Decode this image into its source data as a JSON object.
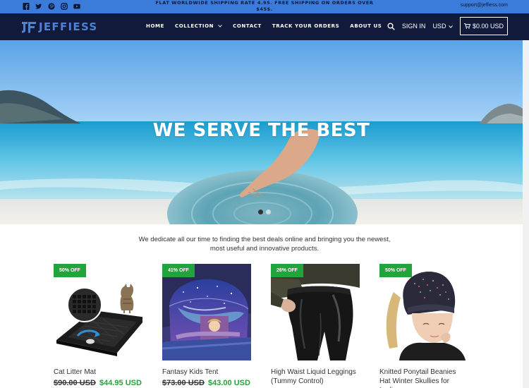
{
  "topbar": {
    "social_icons": [
      "facebook-icon",
      "twitter-icon",
      "pinterest-icon",
      "instagram-icon",
      "youtube-icon"
    ],
    "announcement": "FLAT WORLDWIDE SHIPPING RATE 4.95. FREE SHIPPING ON ORDERS OVER $45$.",
    "support_email": "support@jeffiess.com"
  },
  "header": {
    "logo_text": "JEFFIESS",
    "nav": [
      "HOME",
      "COLLECTION",
      "CONTACT",
      "TRACK YOUR ORDERS",
      "ABOUT US"
    ],
    "collection_chevron": "⌄",
    "signin": "SIGN IN",
    "currency": "USD",
    "cart": "$0.00 USD"
  },
  "hero": {
    "title": "WE SERVE THE BEST",
    "slides": 2,
    "active_slide": 1
  },
  "intro": "We dedicate all our time to finding the best deals online and bringing you the newest, most useful and innovative products.",
  "products": [
    {
      "badge": "50% OFF",
      "name": "Cat Litter Mat",
      "old_price": "$90.00 USD",
      "new_price": "$44.95 USD"
    },
    {
      "badge": "41% OFF",
      "name": "Fantasy Kids Tent",
      "old_price": "$73.00 USD",
      "new_price": "$43.00 USD"
    },
    {
      "badge": "26% OFF",
      "name": "High Waist Liquid Leggings (Tummy Control)",
      "old_price": "",
      "new_price": ""
    },
    {
      "badge": "50% OFF",
      "name": "Knitted Ponytail Beanies Hat Winter Skullies for Ladies",
      "old_price": "",
      "new_price": ""
    }
  ],
  "colors": {
    "topbar": "#3b7bd9",
    "header": "#111a3b",
    "brand": "#4f82d6",
    "badge": "#21a43b",
    "sale_price": "#21a43b"
  }
}
